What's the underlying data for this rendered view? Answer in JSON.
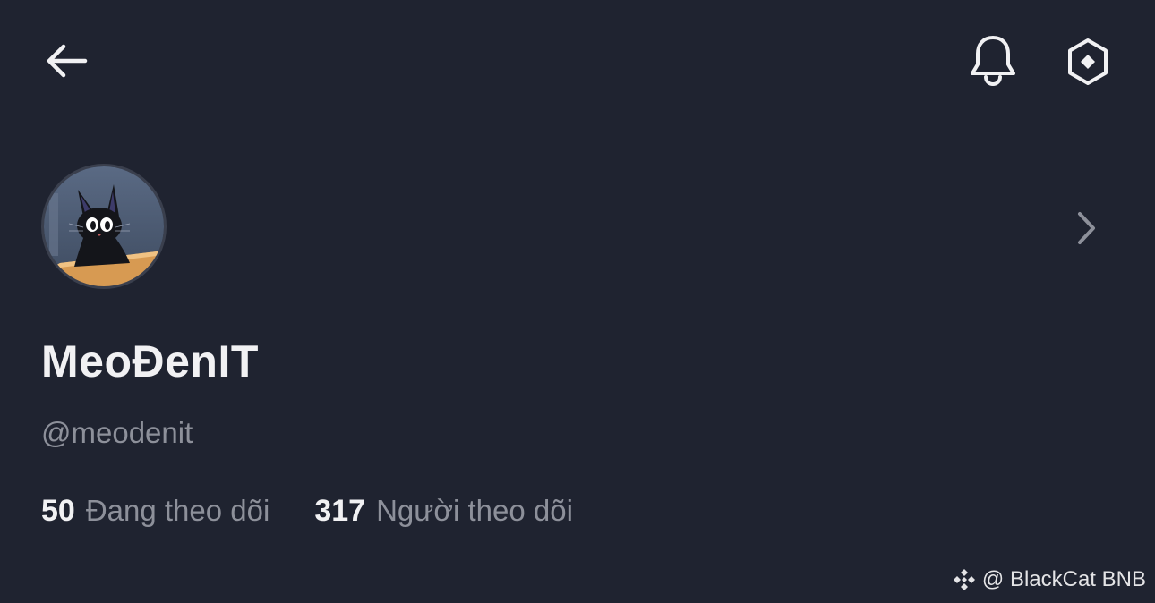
{
  "top_bar": {
    "back_icon": "arrow-left-icon",
    "notifications_icon": "bell-icon",
    "settings_icon": "hexagon-settings-icon"
  },
  "profile": {
    "avatar_icon": "black-cat-avatar",
    "display_name": "MeoĐenIT",
    "username": "@meodenit",
    "following_count": "50",
    "following_label": "Đang theo dõi",
    "followers_count": "317",
    "followers_label": "Người theo dõi"
  },
  "watermark": {
    "text": "@ BlackCat BNB"
  },
  "colors": {
    "background": "#1f2330",
    "primary_text": "#f1f1f3",
    "secondary_text": "#8d909a"
  }
}
